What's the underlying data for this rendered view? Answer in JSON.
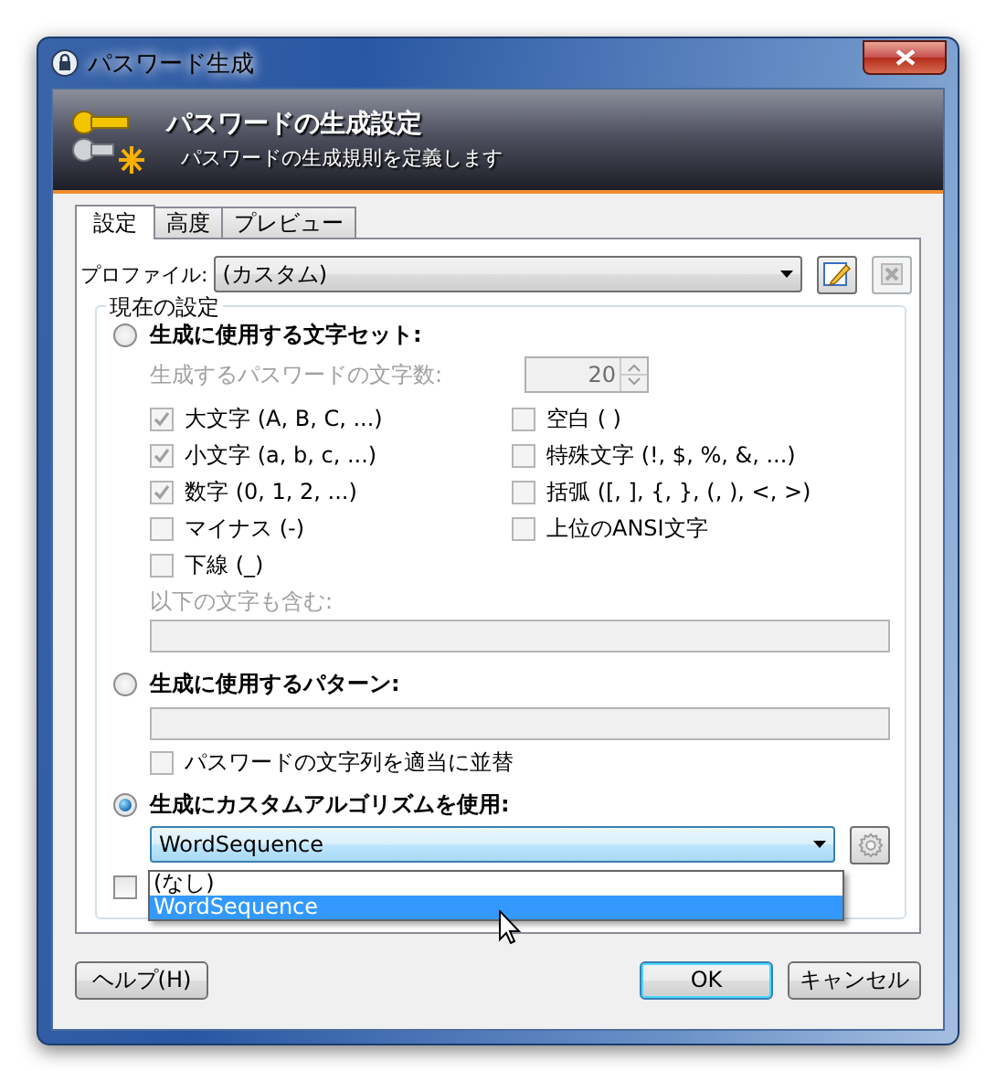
{
  "window": {
    "title": "パスワード生成"
  },
  "header": {
    "title": "パスワードの生成設定",
    "subtitle": "パスワードの生成規則を定義します"
  },
  "tabs": [
    {
      "label": "設定",
      "selected": true
    },
    {
      "label": "高度",
      "selected": false
    },
    {
      "label": "プレビュー",
      "selected": false
    }
  ],
  "profile": {
    "label": "プロファイル:",
    "value": "(カスタム)"
  },
  "group": {
    "title": "現在の設定"
  },
  "charset_option": {
    "label": "生成に使用する文字セット:",
    "selected": false
  },
  "length": {
    "label": "生成するパスワードの文字数:",
    "value": "20",
    "disabled": true
  },
  "charsets_left": [
    {
      "label": "大文字 (A, B, C, ...)",
      "checked": true,
      "disabled": true
    },
    {
      "label": "小文字 (a, b, c, ...)",
      "checked": true,
      "disabled": true
    },
    {
      "label": "数字 (0, 1, 2, ...)",
      "checked": true,
      "disabled": true
    },
    {
      "label": "マイナス (-)",
      "checked": false,
      "disabled": true
    },
    {
      "label": "下線 (_)",
      "checked": false,
      "disabled": true
    }
  ],
  "charsets_right": [
    {
      "label": "空白 ( )",
      "checked": false,
      "disabled": true
    },
    {
      "label": "特殊文字 (!, $, %, &, ...)",
      "checked": false,
      "disabled": true
    },
    {
      "label": "括弧 ([, ], {, }, (, ), <, >)",
      "checked": false,
      "disabled": true
    },
    {
      "label": "上位のANSI文字",
      "checked": false,
      "disabled": true
    }
  ],
  "extra_chars": {
    "label": "以下の文字も含む:",
    "disabled": true
  },
  "pattern_option": {
    "label": "生成に使用するパターン:",
    "selected": false
  },
  "permute": {
    "label": "パスワードの文字列を適当に並替",
    "checked": false,
    "disabled": true
  },
  "custom_option": {
    "label": "生成にカスタムアルゴリズムを使用:",
    "selected": true
  },
  "algorithm": {
    "value": "WordSequence",
    "expanded": true,
    "options": [
      {
        "label": "(なし)",
        "selected": false
      },
      {
        "label": "WordSequence",
        "selected": true
      }
    ]
  },
  "bottom_checkbox": {
    "checked": false
  },
  "buttons": [
    {
      "label": "ヘルプ(H)",
      "kind": "help"
    },
    {
      "label": "OK",
      "kind": "default"
    },
    {
      "label": "キャンセル",
      "kind": "cancel"
    }
  ]
}
